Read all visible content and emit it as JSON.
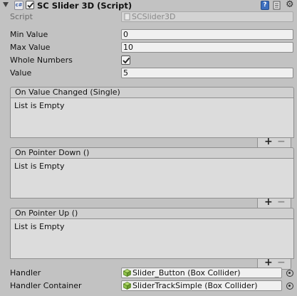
{
  "header": {
    "title": "SC Slider 3D (Script)",
    "enabled": true,
    "script_icon_text": "c#"
  },
  "script": {
    "label": "Script",
    "value": "SCSlider3D"
  },
  "min_value": {
    "label": "Min Value",
    "value": "0"
  },
  "max_value": {
    "label": "Max Value",
    "value": "10"
  },
  "whole_numbers": {
    "label": "Whole Numbers",
    "checked": true
  },
  "value": {
    "label": "Value",
    "value": "5"
  },
  "events": [
    {
      "title": "On Value Changed (Single)",
      "empty_text": "List is Empty"
    },
    {
      "title": "On Pointer Down ()",
      "empty_text": "List is Empty"
    },
    {
      "title": "On Pointer Up ()",
      "empty_text": "List is Empty"
    }
  ],
  "list_buttons": {
    "add": "+",
    "remove": "−"
  },
  "handler": {
    "label": "Handler",
    "value": "Slider_Button (Box Collider)"
  },
  "handler_container": {
    "label": "Handler Container",
    "value": "SliderTrackSimple (Box Collider)"
  },
  "colors": {
    "background": "#c2c2c2",
    "field": "#f0f0f0",
    "help_icon": "#3d6fbf",
    "cube_icon": "#8fc24a"
  }
}
